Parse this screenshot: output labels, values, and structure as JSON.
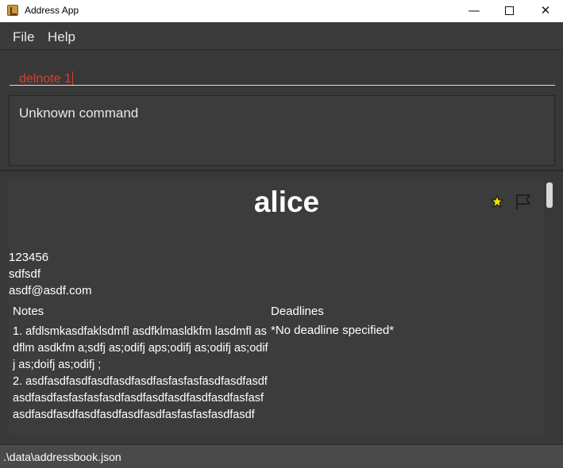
{
  "window": {
    "title": "Address App",
    "minimize_glyph": "—",
    "close_glyph": "✕"
  },
  "menu": {
    "file": "File",
    "help": "Help"
  },
  "command": {
    "value": "delnote 1"
  },
  "result": {
    "message": "Unknown command"
  },
  "person": {
    "name": "alice",
    "phone": "123456",
    "address": "sdfsdf",
    "email": "asdf@asdf.com",
    "notes_header": "Notes",
    "deadlines_header": "Deadlines",
    "notes": [
      "1. afdlsmkasdfaklsdmfl asdfklmasldkfm lasdmfl asdflm asdkfm a;sdfj as;odifj aps;odifj as;odifj as;odifj as;doifj as;odifj ;",
      "2. asdfasdfasdfasdfasdfasdfasfasfasfasdfasdfasdfasdfasdfasfasfasfasdfasdfasdfasdfasdfasdfasfasfasdfasdfasdfasdfasdfasdfasdfasfasfasfasdfasdf"
    ],
    "deadline": "*No deadline specified*",
    "favourite_icon": "star-icon",
    "flag_icon": "flag-icon",
    "star_color": "#f5e400"
  },
  "status": {
    "path": ".\\data\\addressbook.json"
  },
  "colors": {
    "background": "#383838",
    "command_text": "#d0442e"
  }
}
